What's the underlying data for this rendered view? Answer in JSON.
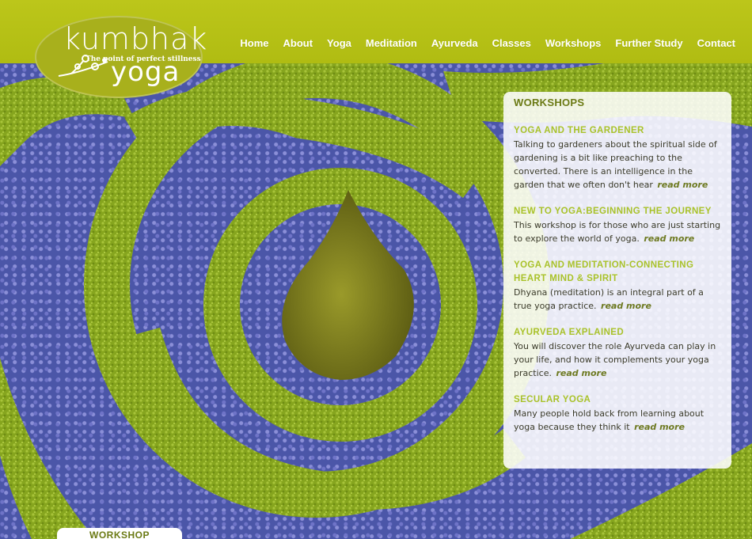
{
  "brand": {
    "logo_word_top": "kumbhak",
    "logo_tagline": "The point of perfect stillness",
    "logo_word_bottom": "yoga"
  },
  "nav": {
    "items": [
      {
        "label": "Home"
      },
      {
        "label": "About"
      },
      {
        "label": "Yoga"
      },
      {
        "label": "Meditation"
      },
      {
        "label": "Ayurveda"
      },
      {
        "label": "Classes"
      },
      {
        "label": "Workshops"
      },
      {
        "label": "Further Study"
      },
      {
        "label": "Contact"
      }
    ]
  },
  "panel": {
    "title": "WORKSHOPS",
    "items": [
      {
        "heading": "YOGA AND THE GARDENER",
        "text": "Talking to gardeners about the spiritual side of gardening is a bit like preaching to the converted. There is an intelligence in the garden that we often don't hear",
        "link": "read more"
      },
      {
        "heading": "NEW TO YOGA:BEGINNING THE JOURNEY",
        "text": "This workshop is for those who are just starting to explore the world of yoga.",
        "link": "read more"
      },
      {
        "heading": "YOGA AND MEDITATION-CONNECTING HEART MIND & SPIRIT",
        "text": "Dhyana (meditation) is an integral part of a true yoga practice.",
        "link": "read more"
      },
      {
        "heading": "AYURVEDA EXPLAINED",
        "text": "You will discover the role Ayurveda can play in your life, and how it complements your yoga practice.",
        "link": "read more"
      },
      {
        "heading": "SECULAR YOGA",
        "text": "Many people hold back from learning about yoga because they think it",
        "link": "read more"
      }
    ]
  },
  "bottom_tab": {
    "label": "WORKSHOP"
  },
  "colors": {
    "header_green": "#b4bf16",
    "heading_green": "#a9c22a",
    "title_green": "#6b7a14",
    "hedge_green": "#8fae22",
    "flower_blue": "#5660b8"
  }
}
